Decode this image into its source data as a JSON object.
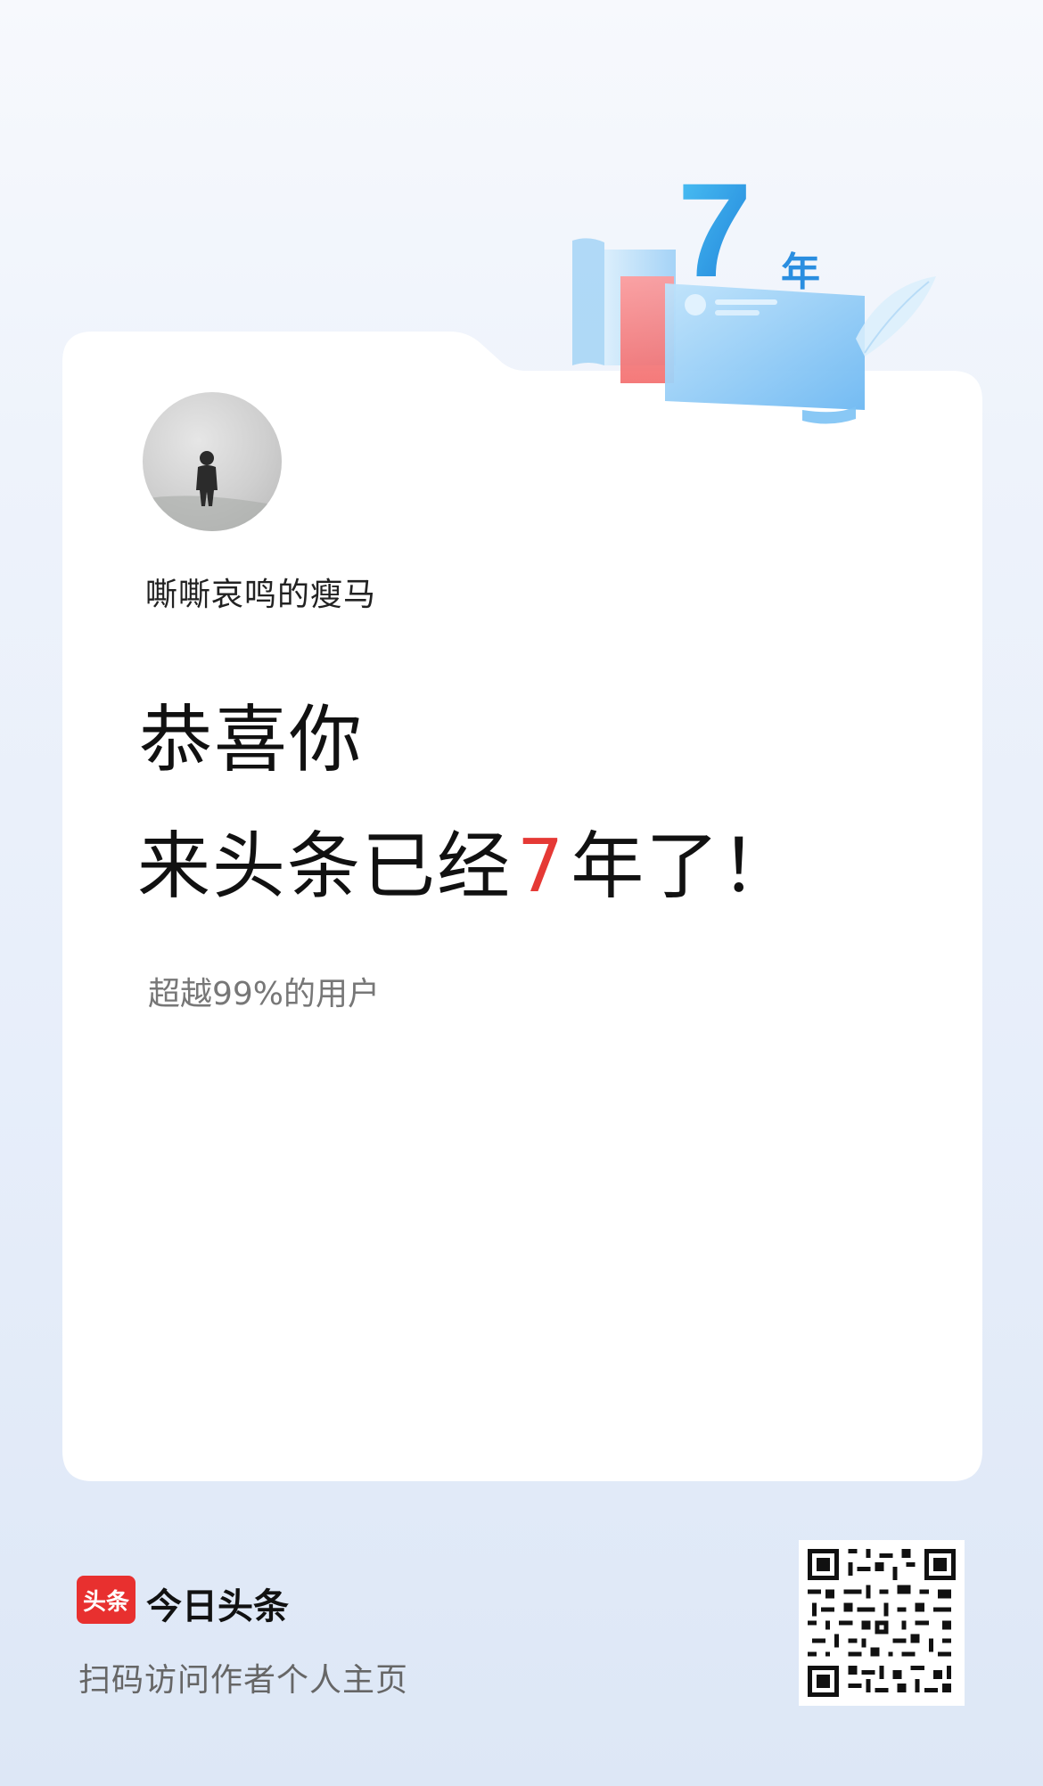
{
  "badge": {
    "number": "7",
    "unit": "年"
  },
  "profile": {
    "username": "嘶嘶哀鸣的瘦马"
  },
  "congrats": {
    "line1": "恭喜你",
    "line2_prefix": "来头条已经",
    "years": "7",
    "line2_suffix": "年了！",
    "percent": "超越99%的用户"
  },
  "footer": {
    "logo_text": "头条",
    "brand_name": "今日头条",
    "scan_hint": "扫码访问作者个人主页"
  },
  "colors": {
    "accent_red": "#e53935",
    "brand_red": "#e8302f",
    "badge_blue": "#2aa8e6"
  }
}
